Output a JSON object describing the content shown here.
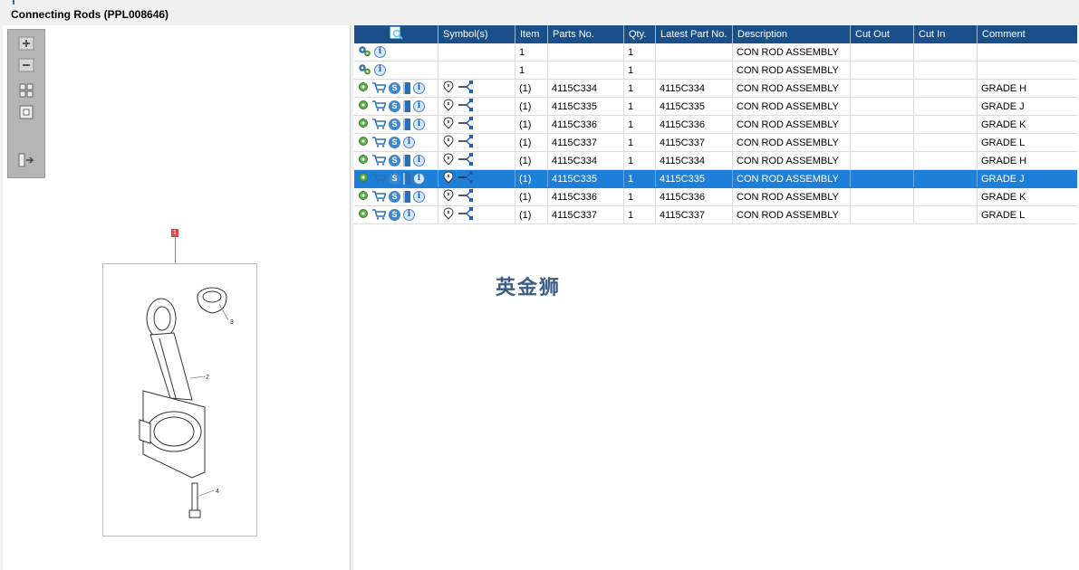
{
  "window": {
    "title": "Connecting Rods (PPL008646)"
  },
  "toolbar": {
    "buttons": [
      {
        "name": "zoom-in-icon"
      },
      {
        "name": "zoom-out-icon"
      },
      {
        "name": "fit-all-icon"
      },
      {
        "name": "fit-window-icon"
      },
      {
        "name": "export-icon"
      }
    ]
  },
  "drawing": {
    "callouts": [
      "1",
      "2",
      "3",
      "4"
    ]
  },
  "table": {
    "headers": [
      "",
      "Symbol(s)",
      "Item",
      "Parts No.",
      "Qty.",
      "Latest Part No.",
      "Description",
      "Cut Out",
      "Cut In",
      "Comment"
    ],
    "rows": [
      {
        "icons": [
          "gears",
          "info"
        ],
        "symbols": [],
        "item": "1",
        "parts_no": "",
        "qty": "1",
        "latest": "",
        "desc": "CON ROD ASSEMBLY",
        "cut_out": "",
        "cut_in": "",
        "comment": ""
      },
      {
        "icons": [
          "gears",
          "info"
        ],
        "symbols": [],
        "item": "1",
        "parts_no": "",
        "qty": "1",
        "latest": "",
        "desc": "CON ROD ASSEMBLY",
        "cut_out": "",
        "cut_in": "",
        "comment": ""
      },
      {
        "icons": [
          "gear",
          "cart",
          "s",
          "book",
          "info"
        ],
        "symbols": [
          "pin",
          "connector"
        ],
        "item": "(1)",
        "parts_no": "4115C334",
        "qty": "1",
        "latest": "4115C334",
        "desc": "CON ROD ASSEMBLY",
        "cut_out": "",
        "cut_in": "",
        "comment": "GRADE H"
      },
      {
        "icons": [
          "gear",
          "cart",
          "s",
          "book",
          "info"
        ],
        "symbols": [
          "pin",
          "connector"
        ],
        "item": "(1)",
        "parts_no": "4115C335",
        "qty": "1",
        "latest": "4115C335",
        "desc": "CON ROD ASSEMBLY",
        "cut_out": "",
        "cut_in": "",
        "comment": "GRADE J"
      },
      {
        "icons": [
          "gear",
          "cart",
          "s",
          "book",
          "info"
        ],
        "symbols": [
          "pin",
          "connector"
        ],
        "item": "(1)",
        "parts_no": "4115C336",
        "qty": "1",
        "latest": "4115C336",
        "desc": "CON ROD ASSEMBLY",
        "cut_out": "",
        "cut_in": "",
        "comment": "GRADE K"
      },
      {
        "icons": [
          "gear",
          "cart",
          "s",
          "info"
        ],
        "symbols": [
          "pin",
          "connector"
        ],
        "item": "(1)",
        "parts_no": "4115C337",
        "qty": "1",
        "latest": "4115C337",
        "desc": "CON ROD ASSEMBLY",
        "cut_out": "",
        "cut_in": "",
        "comment": "GRADE L"
      },
      {
        "icons": [
          "gear",
          "cart",
          "s",
          "book",
          "info"
        ],
        "symbols": [
          "pin",
          "connector"
        ],
        "item": "(1)",
        "parts_no": "4115C334",
        "qty": "1",
        "latest": "4115C334",
        "desc": "CON ROD ASSEMBLY",
        "cut_out": "",
        "cut_in": "",
        "comment": "GRADE H"
      },
      {
        "icons": [
          "gear",
          "cart",
          "s",
          "book",
          "info"
        ],
        "symbols": [
          "pin",
          "connector"
        ],
        "item": "(1)",
        "parts_no": "4115C335",
        "qty": "1",
        "latest": "4115C335",
        "desc": "CON ROD ASSEMBLY",
        "cut_out": "",
        "cut_in": "",
        "comment": "GRADE J",
        "selected": true
      },
      {
        "icons": [
          "gear",
          "cart",
          "s",
          "book",
          "info"
        ],
        "symbols": [
          "pin",
          "connector"
        ],
        "item": "(1)",
        "parts_no": "4115C336",
        "qty": "1",
        "latest": "4115C336",
        "desc": "CON ROD ASSEMBLY",
        "cut_out": "",
        "cut_in": "",
        "comment": "GRADE K"
      },
      {
        "icons": [
          "gear",
          "cart",
          "s",
          "info"
        ],
        "symbols": [
          "pin",
          "connector"
        ],
        "item": "(1)",
        "parts_no": "4115C337",
        "qty": "1",
        "latest": "4115C337",
        "desc": "CON ROD ASSEMBLY",
        "cut_out": "",
        "cut_in": "",
        "comment": "GRADE L"
      }
    ]
  },
  "watermark": "英金狮",
  "colors": {
    "header": "#1b4f8a",
    "selected": "#1e7fd8"
  }
}
